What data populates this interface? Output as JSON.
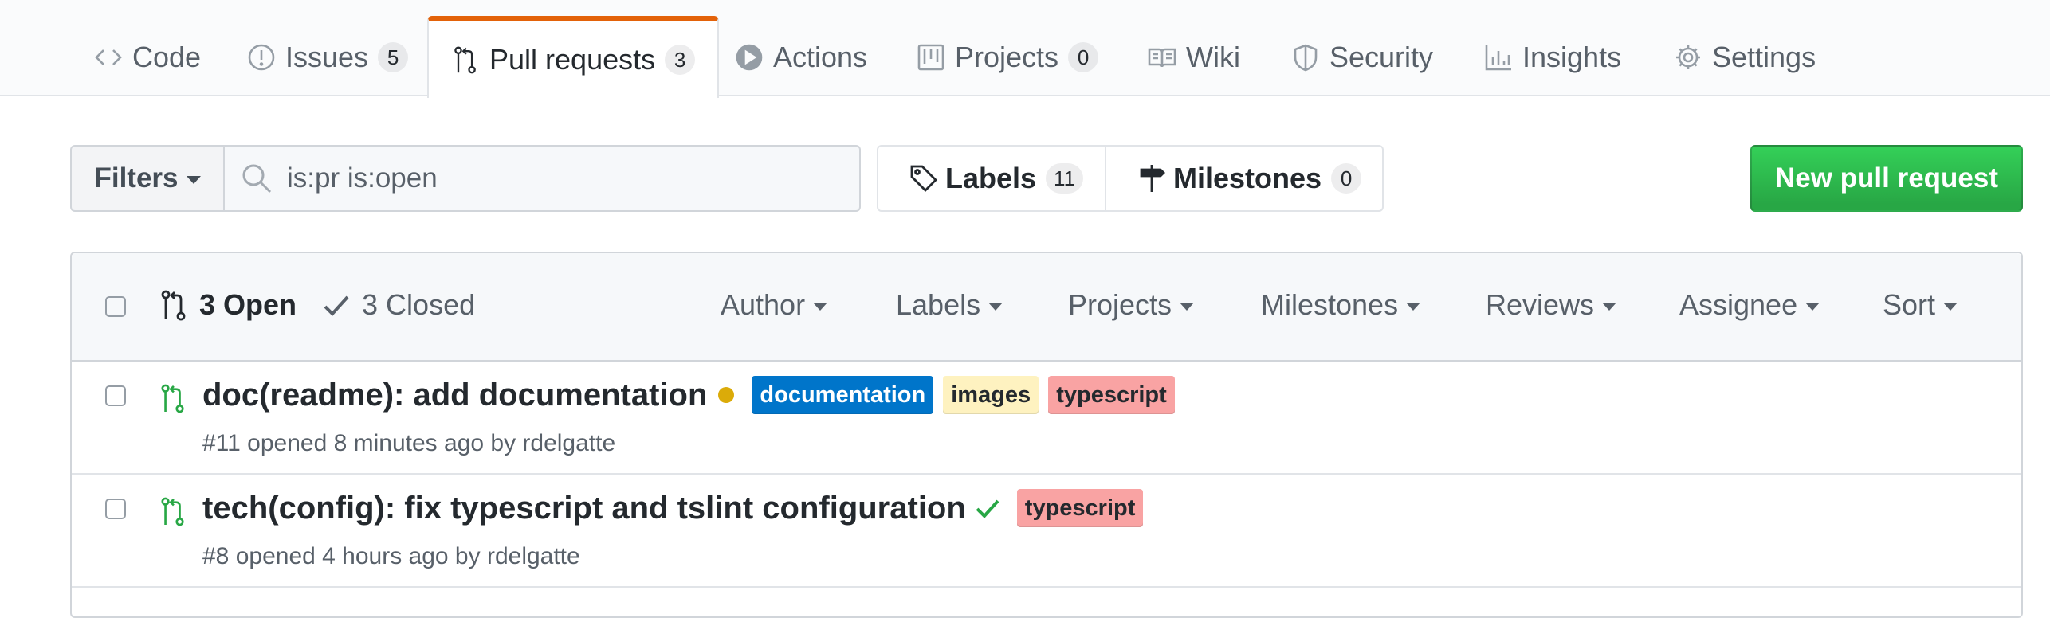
{
  "reponav": {
    "tabs": [
      {
        "label": "Code",
        "icon": "code-icon",
        "count": null
      },
      {
        "label": "Issues",
        "icon": "issue-icon",
        "count": "5"
      },
      {
        "label": "Pull requests",
        "icon": "pull-request-icon",
        "count": "3",
        "selected": true
      },
      {
        "label": "Actions",
        "icon": "play-icon",
        "count": null
      },
      {
        "label": "Projects",
        "icon": "project-icon",
        "count": "0"
      },
      {
        "label": "Wiki",
        "icon": "book-icon",
        "count": null
      },
      {
        "label": "Security",
        "icon": "shield-icon",
        "count": null
      },
      {
        "label": "Insights",
        "icon": "graph-icon",
        "count": null
      },
      {
        "label": "Settings",
        "icon": "gear-icon",
        "count": null
      }
    ],
    "accent": "#e36209"
  },
  "toolbar": {
    "filters_label": "Filters",
    "search_value": "is:pr is:open",
    "labels_label": "Labels",
    "labels_count": "11",
    "milestones_label": "Milestones",
    "milestones_count": "0",
    "new_pr_label": "New pull request",
    "new_pr_color": "#28a745"
  },
  "list_header": {
    "open_label": "3 Open",
    "closed_label": "3 Closed",
    "filters": [
      "Author",
      "Labels",
      "Projects",
      "Milestones",
      "Reviews",
      "Assignee",
      "Sort"
    ]
  },
  "pull_requests": [
    {
      "title": "doc(readme): add documentation",
      "status": "pending",
      "status_color": "#dbab09",
      "labels": [
        {
          "name": "documentation",
          "bg": "#0075ca",
          "fg": "#ffffff"
        },
        {
          "name": "images",
          "bg": "#fef2c0",
          "fg": "#24292e"
        },
        {
          "name": "typescript",
          "bg": "#f9a3a3",
          "fg": "#24292e"
        }
      ],
      "meta": "#11 opened 8 minutes ago by rdelgatte"
    },
    {
      "title": "tech(config): fix typescript and tslint configuration",
      "status": "success",
      "status_color": "#28a745",
      "labels": [
        {
          "name": "typescript",
          "bg": "#f9a3a3",
          "fg": "#24292e"
        }
      ],
      "meta": "#8 opened 4 hours ago by rdelgatte"
    }
  ]
}
